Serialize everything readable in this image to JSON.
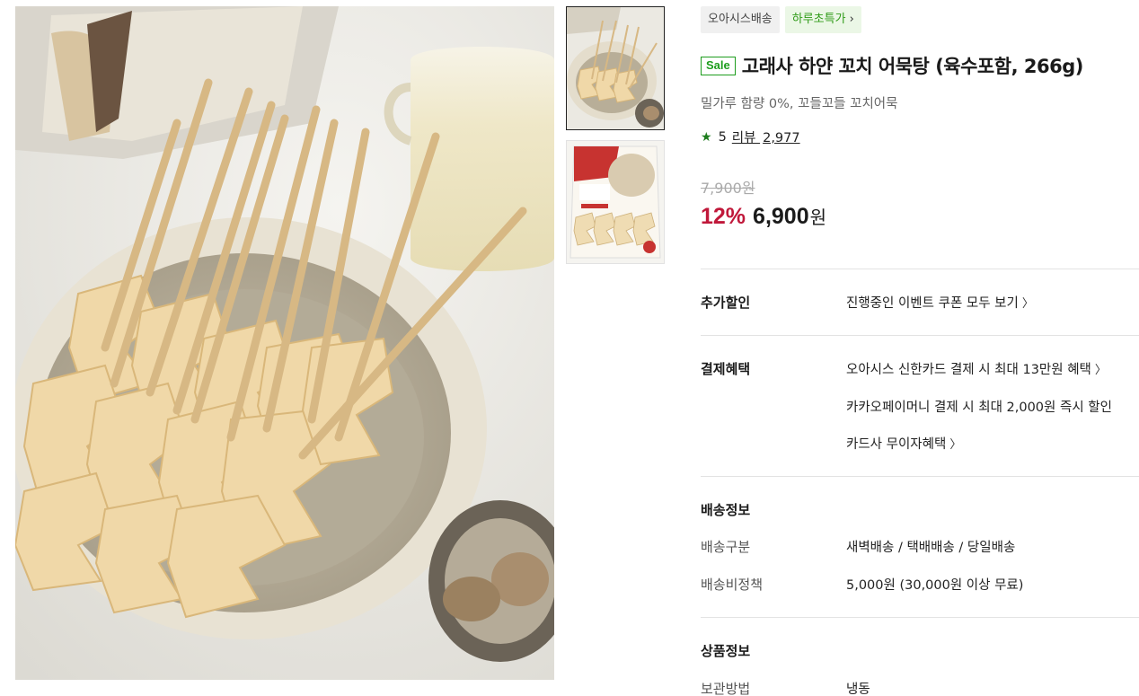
{
  "product": {
    "badges": [
      "오아시스배송",
      "하루초특가"
    ],
    "sale_tag": "Sale",
    "title": "고래사 하얀 꼬치 어묵탕 (육수포함, 266g)",
    "subtitle": "밀가루 함량 0%, 꼬들꼬들 꼬치어묵",
    "rating": "5",
    "review_label": "리뷰",
    "review_count": "2,977",
    "original_price": "7,900원",
    "discount": "12%",
    "price": "6,900",
    "currency": "원"
  },
  "benefits": {
    "extra_discount_label": "추가할인",
    "extra_discount_value": "진행중인 이벤트 쿠폰 모두 보기",
    "payment_label": "결제혜택",
    "payment_items": [
      "오아시스 신한카드 결제 시 최대 13만원 혜택",
      "카카오페이머니 결제 시 최대 2,000원 즉시 할인",
      "카드사 무이자혜택"
    ]
  },
  "delivery": {
    "heading": "배송정보",
    "type_label": "배송구분",
    "type_value": "새벽배송 / 택배배송 / 당일배송",
    "policy_label": "배송비정책",
    "policy_value": "5,000원 (30,000원 이상 무료)"
  },
  "product_info": {
    "heading": "상품정보",
    "storage_label": "보관방법",
    "storage_value": "냉동"
  },
  "icons": {
    "star": "star-icon",
    "chevron": "chevron-right-icon"
  },
  "colors": {
    "accent_green": "#1e9d1e",
    "discount_red": "#c0183a",
    "badge_green_text": "#2f9b18"
  }
}
